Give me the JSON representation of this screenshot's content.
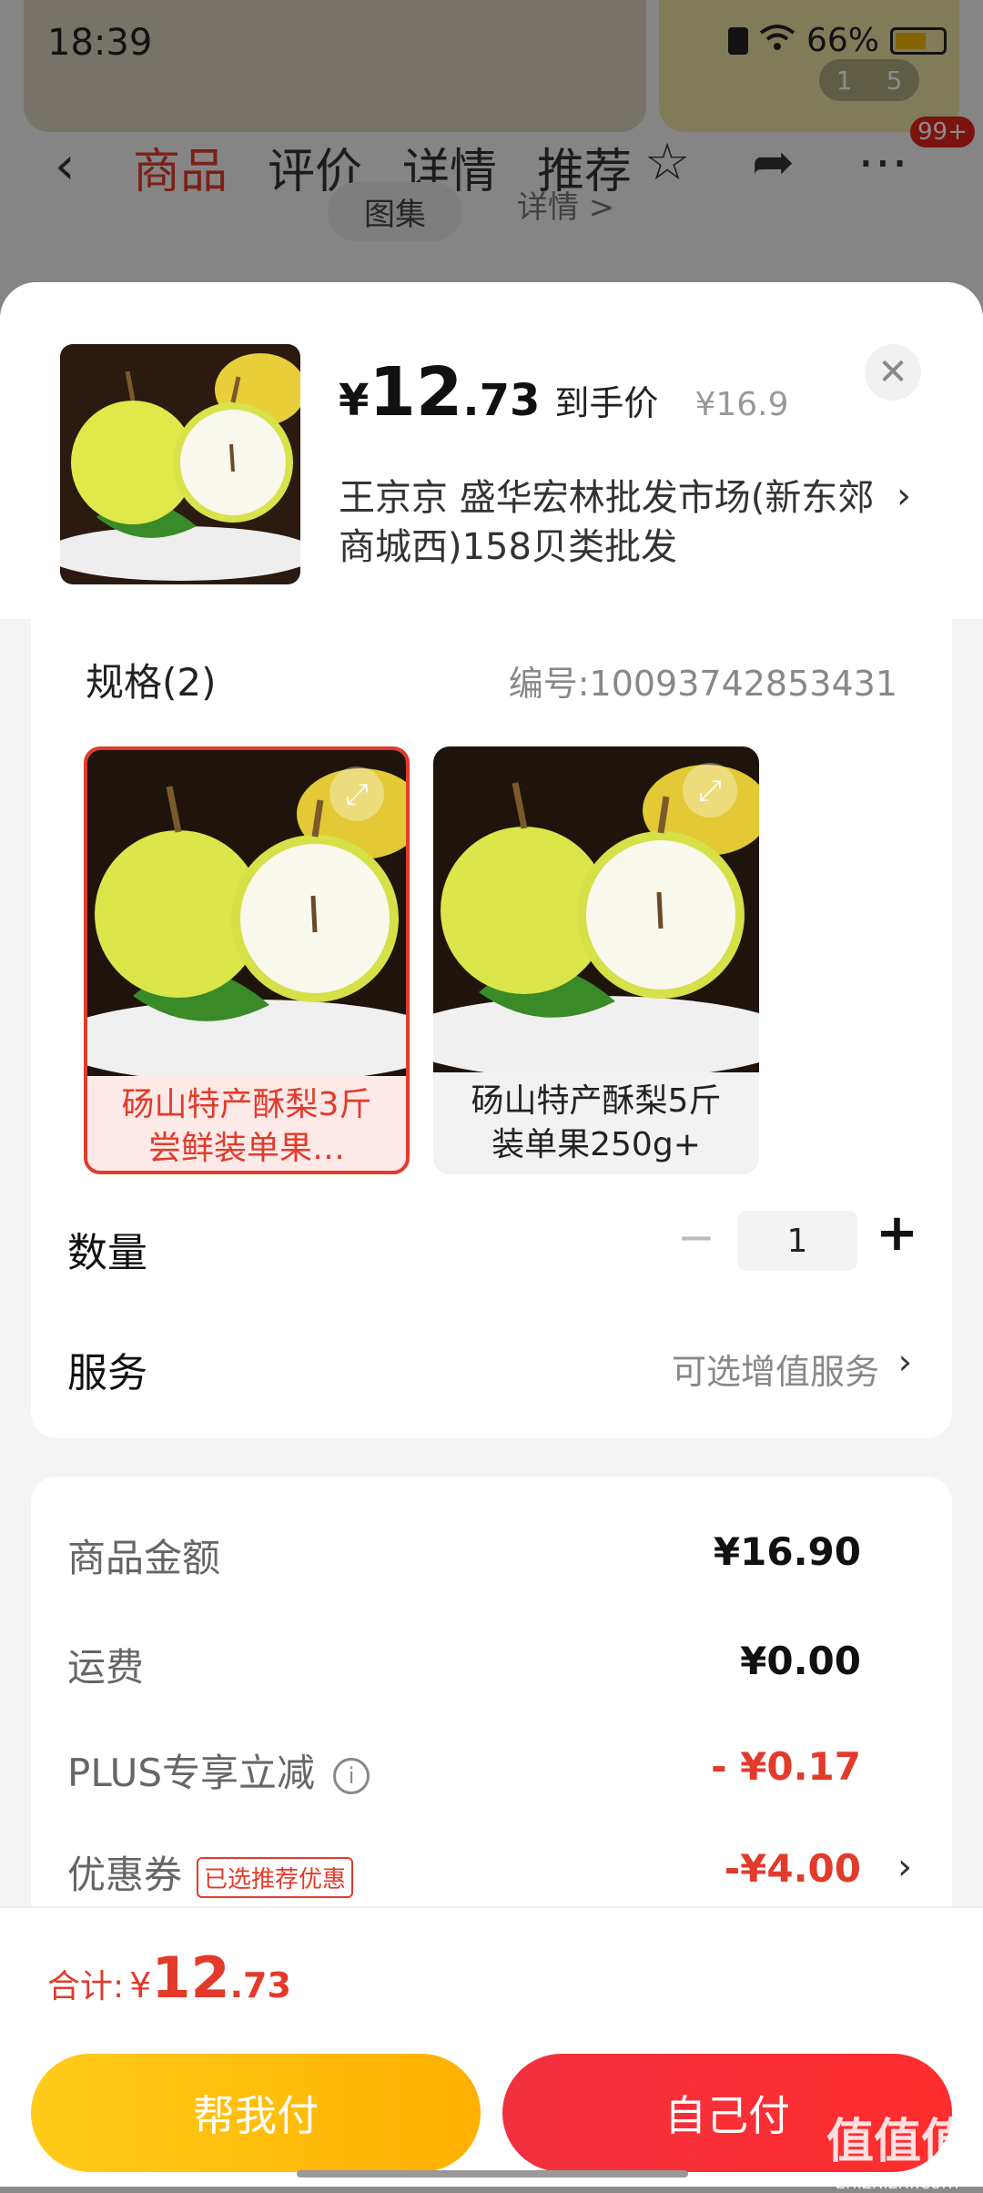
{
  "status_bar": {
    "time": "18:39",
    "battery": "66%",
    "battery_level": 0.66
  },
  "background": {
    "indicator": [
      "1",
      "5"
    ],
    "tabs": [
      "商品",
      "评价",
      "详情",
      "推荐"
    ],
    "badge": "99+",
    "sub_tabs": [
      "图集",
      "详情 >"
    ]
  },
  "product": {
    "price_currency": "¥",
    "price_int": "12",
    "price_dec": ".73",
    "price_tag": "到手价",
    "original_price": "¥16.9",
    "seller": "王京京  盛华宏林批发市场(新东郊商城西)158贝类批发"
  },
  "spec": {
    "title": "规格(2)",
    "code": "编号:10093742853431",
    "variants": [
      {
        "label": "砀山特产酥梨3斤尝鲜装单果…",
        "selected": true
      },
      {
        "label": "砀山特产酥梨5斤装单果250g+",
        "selected": false
      }
    ]
  },
  "quantity": {
    "label": "数量",
    "value": "1",
    "minus": "−",
    "plus": "+"
  },
  "service": {
    "label": "服务",
    "value": "可选增值服务"
  },
  "fees": {
    "goods_label": "商品金额",
    "goods_value": "¥16.90",
    "shipping_label": "运费",
    "shipping_value": "¥0.00",
    "plus_label": "PLUS专享立减",
    "plus_value": "- ¥0.17",
    "coupon_label": "优惠券",
    "coupon_tag": "已选推荐优惠",
    "coupon_value": "-¥4.00"
  },
  "total": {
    "label": "合计:",
    "currency": "¥",
    "int": "12",
    "dec": ".73"
  },
  "buttons": {
    "help_pay": "帮我付",
    "self_pay": "自己付"
  },
  "watermark": {
    "text": "值值值",
    "sub": "zhizhizhi.com"
  }
}
